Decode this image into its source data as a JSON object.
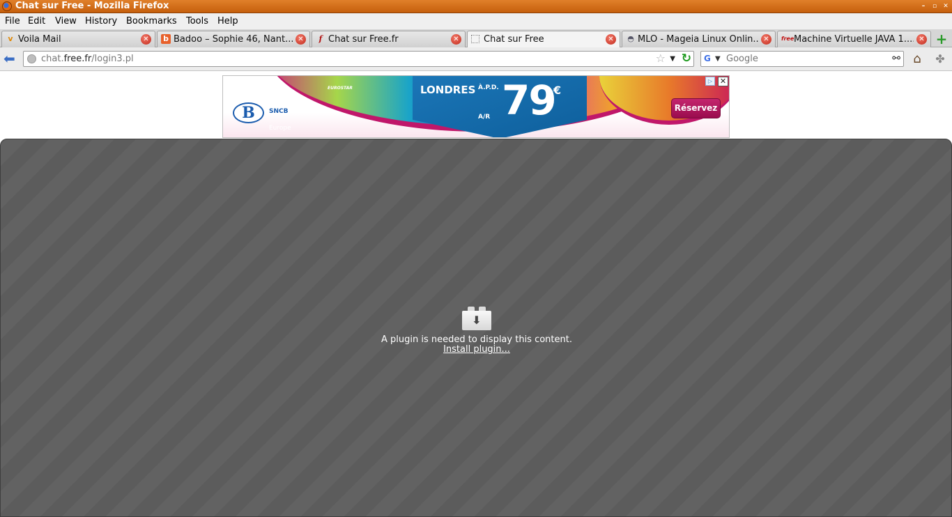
{
  "window": {
    "title": "Chat sur Free - Mozilla Firefox"
  },
  "menu": [
    "File",
    "Edit",
    "View",
    "History",
    "Bookmarks",
    "Tools",
    "Help"
  ],
  "tabs": [
    {
      "label": "Voila Mail",
      "icon": "voila-icon"
    },
    {
      "label": "Badoo – Sophie 46, Nant...",
      "icon": "badoo-icon"
    },
    {
      "label": "Chat sur Free.fr",
      "icon": "flash-icon"
    },
    {
      "label": "Chat sur Free",
      "icon": "blank-page-icon",
      "active": true
    },
    {
      "label": "MLO - Mageia Linux Onlin...",
      "icon": "mageia-icon"
    },
    {
      "label": "Machine Virtuelle JAVA 1....",
      "icon": "free-icon"
    }
  ],
  "address": {
    "prefix": "chat.",
    "host": "free.fr",
    "path": "/login3.pl"
  },
  "search": {
    "placeholder": "Google"
  },
  "ad": {
    "brand": "SNCB",
    "region": "Europe",
    "partner": "EUROSTAR",
    "destination": "LONDRES",
    "from_label": "À.P.D.",
    "trip_label": "A/R",
    "price": "79",
    "currency": "€",
    "cta": "Réservez"
  },
  "plugin": {
    "message": "A plugin is needed to display this content.",
    "install_label": "Install plugin..."
  },
  "colors": {
    "titlebar": "#d0680f",
    "plugin_bg": "#606060",
    "ad_cta": "#b0185e",
    "ad_panel": "#1b76b7"
  }
}
